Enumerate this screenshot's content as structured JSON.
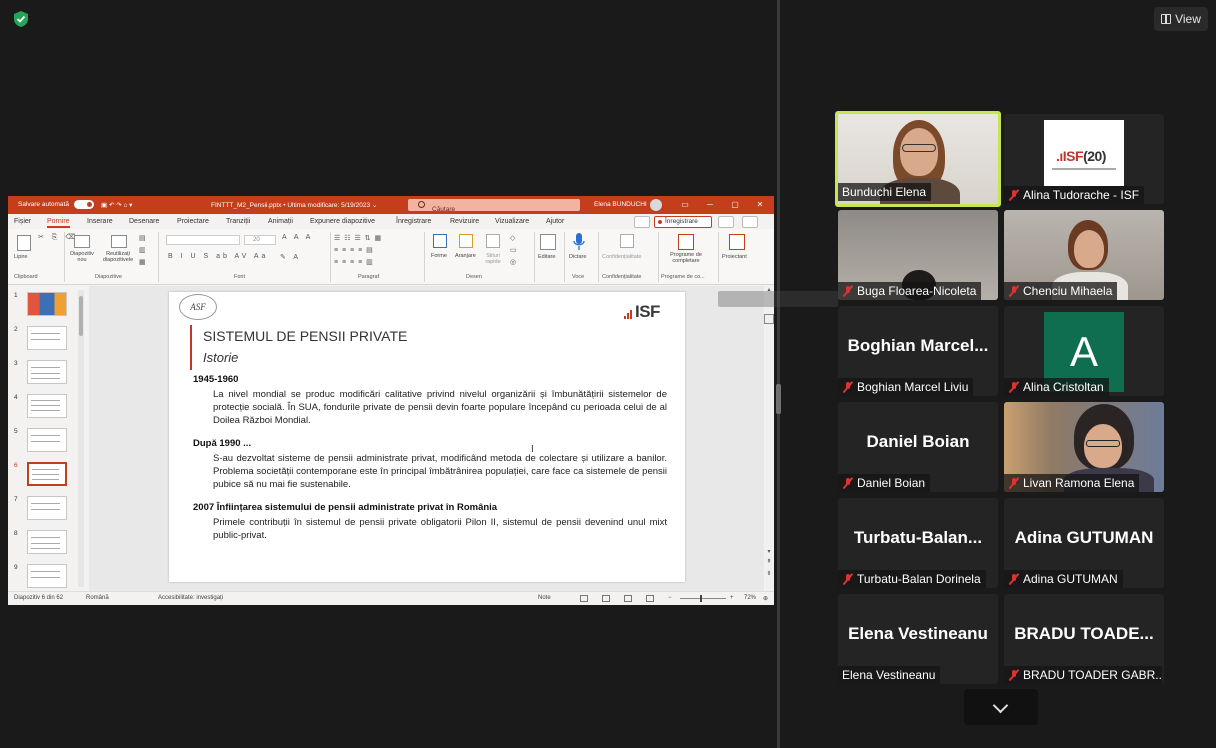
{
  "meeting": {
    "view_label": "View",
    "colors": {
      "speaking_border": "#c7e455",
      "mute_red": "#e03030",
      "ppt_accent": "#c43e1c"
    }
  },
  "ppt": {
    "titlebar": {
      "autosave": "Salvare automată",
      "filename": "FINTTT_M2_Pensii.pptx • Ultima modificare: 5/19/2023 ⌄",
      "search": "Căutare",
      "user": "Elena BUNDUCHI"
    },
    "menu": [
      "Fișier",
      "Pornire",
      "Inserare",
      "Desenare",
      "Proiectare",
      "Tranziții",
      "Animații",
      "Expunere diapozitive",
      "Înregistrare",
      "Revizuire",
      "Vizualizare",
      "Ajutor"
    ],
    "record_button": "Înregistrare",
    "ribbon": {
      "paste": "Lipire",
      "new_slide": "Diapozitiv nou",
      "reuse": "Reutilizați diapozitivele",
      "shapes": "Forme",
      "arrange": "Aranjare",
      "quick_styles": "Stiluri rapide",
      "edit": "Editare",
      "dictate": "Dictare",
      "confidentiality": "Confidențialitate",
      "complete": "Programe de completare",
      "designer": "Proiectant",
      "font_size": "20",
      "groups": {
        "clipboard": "Clipboard",
        "slides": "Diapozitive",
        "font": "Font",
        "paragraph": "Paragraf",
        "drawing": "Desen",
        "voice": "Voce",
        "sensitivity": "Confidențialitate",
        "addins": "Programe de co..."
      }
    },
    "thumbnails": [
      "1",
      "2",
      "3",
      "4",
      "5",
      "6",
      "7",
      "8",
      "9"
    ],
    "slide": {
      "logo_left": "ASF",
      "logo_right": "ISF",
      "title": "SISTEMUL DE PENSII PRIVATE",
      "subtitle": "Istorie",
      "sections": [
        {
          "heading": "1945-1960",
          "body": "La nivel mondial se produc modificări calitative privind nivelul organizării și îmbunătățirii sistemelor de protecție socială. În SUA, fondurile private de pensii devin foarte populare începând cu perioada celui de al Doilea Război Mondial."
        },
        {
          "heading": "După 1990 ...",
          "body": "S-au dezvoltat sisteme de pensii administrate privat, modificând metoda de colectare și utilizare a banilor. Problema societății contemporane este în principal îmbătrânirea populației, care face ca sistemele de pensii pubice să nu mai fie sustenabile."
        },
        {
          "heading": "2007 Înființarea sistemului de pensii administrate privat în România",
          "body": "Primele contribuții în sistemul de pensii private obligatorii Pilon II, sistemul de pensii devenind unul mixt public-privat."
        }
      ]
    },
    "status": {
      "slide_count": "Diapozitiv 6 din 62",
      "language": "Română",
      "accessibility": "Accesibilitate: investigați",
      "notes": "Note",
      "zoom": "72%"
    }
  },
  "participants": [
    {
      "name": "Bunduchi Elena",
      "muted": false,
      "speaking": true,
      "type": "video1"
    },
    {
      "name": "Alina Tudorache - ISF",
      "muted": true,
      "type": "isf"
    },
    {
      "name": "Buga Floarea-Nicoleta",
      "muted": true,
      "type": "video2"
    },
    {
      "name": "Chenciu Mihaela",
      "muted": true,
      "type": "video3"
    },
    {
      "name": "Boghian Marcel Liviu",
      "muted": true,
      "type": "text",
      "big": "Boghian  Marcel..."
    },
    {
      "name": "Alina Cristoltan",
      "muted": true,
      "type": "avatar",
      "big": "A"
    },
    {
      "name": "Daniel Boian",
      "muted": true,
      "type": "text",
      "big": "Daniel Boian"
    },
    {
      "name": "Livan Ramona Elena",
      "muted": true,
      "type": "video4"
    },
    {
      "name": "Turbatu-Balan Dorinela",
      "muted": true,
      "type": "text",
      "big": "Turbatu-Balan..."
    },
    {
      "name": "Adina GUTUMAN",
      "muted": true,
      "type": "text",
      "big": "Adina GUTUMAN"
    },
    {
      "name": "Elena Vestineanu",
      "muted": false,
      "type": "text",
      "big": "Elena Vestineanu"
    },
    {
      "name": "BRADU TOADER GABR...",
      "muted": true,
      "type": "text",
      "big": "BRADU  TOADE..."
    }
  ]
}
